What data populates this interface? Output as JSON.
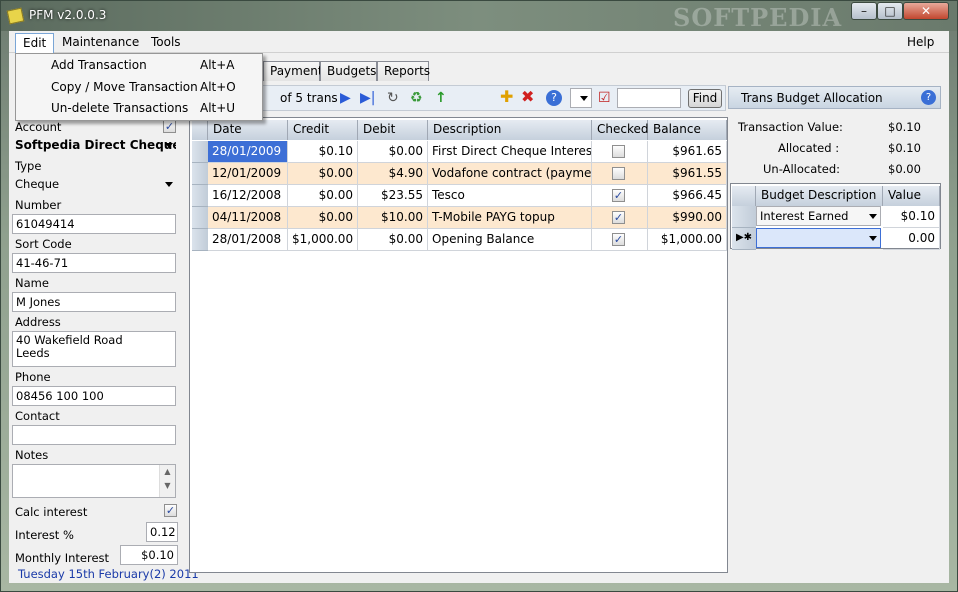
{
  "window": {
    "title": "PFM v2.0.0.3",
    "watermark": "SOFTPEDIA"
  },
  "menubar": {
    "edit": "Edit",
    "maintenance": "Maintenance",
    "tools": "Tools",
    "help": "Help"
  },
  "edit_menu": [
    {
      "label": "Add Transaction",
      "shortcut": "Alt+A"
    },
    {
      "label": "Copy / Move Transaction",
      "shortcut": "Alt+O"
    },
    {
      "label": "Un-delete Transactions",
      "shortcut": "Alt+U"
    }
  ],
  "account": {
    "account_label": "Account",
    "account_value": "Softpedia Direct Cheque",
    "type_label": "Type",
    "type_value": "Cheque",
    "number_label": "Number",
    "number_value": "61049414",
    "sort_label": "Sort Code",
    "sort_value": "41-46-71",
    "name_label": "Name",
    "name_value": "M Jones",
    "address_label": "Address",
    "address_line1": "40 Wakefield Road",
    "address_line2": "Leeds",
    "phone_label": "Phone",
    "phone_value": "08456 100 100",
    "contact_label": "Contact",
    "contact_value": "",
    "notes_label": "Notes",
    "notes_value": "",
    "calc_label": "Calc interest",
    "interest_label": "Interest %",
    "interest_value": "0.12",
    "monthly_label": "Monthly Interest",
    "monthly_value": "$0.10"
  },
  "status": {
    "date": "Tuesday 15th February(2) 2011"
  },
  "tabs": [
    "Payments",
    "Budgets",
    "Reports"
  ],
  "toolbar": {
    "count": "of 5 trans",
    "find": "Find"
  },
  "grid": {
    "headers": [
      "Date",
      "Credit",
      "Debit",
      "Description",
      "Checked",
      "Balance"
    ],
    "rows": [
      {
        "date": "28/01/2009",
        "credit": "$0.10",
        "debit": "$0.00",
        "desc": "First Direct Cheque Interest (pa...",
        "checked": false,
        "balance": "$961.65"
      },
      {
        "date": "12/01/2009",
        "credit": "$0.00",
        "debit": "$4.90",
        "desc": "Vodafone contract (payment)",
        "checked": false,
        "balance": "$961.55"
      },
      {
        "date": "16/12/2008",
        "credit": "$0.00",
        "debit": "$23.55",
        "desc": "Tesco",
        "checked": true,
        "balance": "$966.45"
      },
      {
        "date": "04/11/2008",
        "credit": "$0.00",
        "debit": "$10.00",
        "desc": "T-Mobile PAYG topup",
        "checked": true,
        "balance": "$990.00"
      },
      {
        "date": "28/01/2008",
        "credit": "$1,000.00",
        "debit": "$0.00",
        "desc": "Opening Balance",
        "checked": true,
        "balance": "$1,000.00"
      }
    ]
  },
  "allocation": {
    "title": "Trans Budget Allocation",
    "tv_label": "Transaction Value:",
    "tv_value": "$0.10",
    "al_label": "Allocated :",
    "al_value": "$0.10",
    "un_label": "Un-Allocated:",
    "un_value": "$0.00",
    "headers": [
      "Budget Description",
      "Value"
    ],
    "rows": [
      {
        "budget": "Interest Earned",
        "value": "$0.10"
      },
      {
        "budget": "",
        "value": "0.00"
      }
    ]
  }
}
